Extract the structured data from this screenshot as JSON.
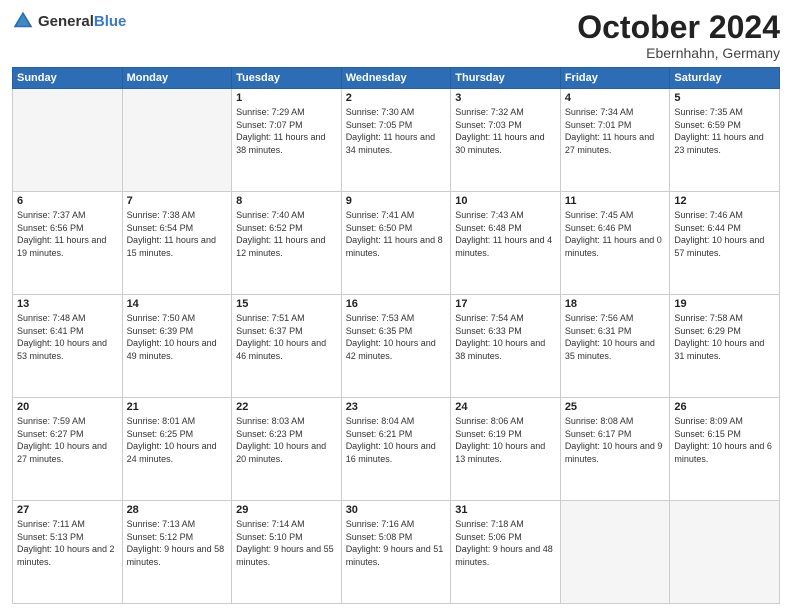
{
  "header": {
    "logo_general": "General",
    "logo_blue": "Blue",
    "title": "October 2024",
    "location": "Ebernhahn, Germany"
  },
  "days_of_week": [
    "Sunday",
    "Monday",
    "Tuesday",
    "Wednesday",
    "Thursday",
    "Friday",
    "Saturday"
  ],
  "weeks": [
    [
      {
        "day": "",
        "info": ""
      },
      {
        "day": "",
        "info": ""
      },
      {
        "day": "1",
        "info": "Sunrise: 7:29 AM\nSunset: 7:07 PM\nDaylight: 11 hours and 38 minutes."
      },
      {
        "day": "2",
        "info": "Sunrise: 7:30 AM\nSunset: 7:05 PM\nDaylight: 11 hours and 34 minutes."
      },
      {
        "day": "3",
        "info": "Sunrise: 7:32 AM\nSunset: 7:03 PM\nDaylight: 11 hours and 30 minutes."
      },
      {
        "day": "4",
        "info": "Sunrise: 7:34 AM\nSunset: 7:01 PM\nDaylight: 11 hours and 27 minutes."
      },
      {
        "day": "5",
        "info": "Sunrise: 7:35 AM\nSunset: 6:59 PM\nDaylight: 11 hours and 23 minutes."
      }
    ],
    [
      {
        "day": "6",
        "info": "Sunrise: 7:37 AM\nSunset: 6:56 PM\nDaylight: 11 hours and 19 minutes."
      },
      {
        "day": "7",
        "info": "Sunrise: 7:38 AM\nSunset: 6:54 PM\nDaylight: 11 hours and 15 minutes."
      },
      {
        "day": "8",
        "info": "Sunrise: 7:40 AM\nSunset: 6:52 PM\nDaylight: 11 hours and 12 minutes."
      },
      {
        "day": "9",
        "info": "Sunrise: 7:41 AM\nSunset: 6:50 PM\nDaylight: 11 hours and 8 minutes."
      },
      {
        "day": "10",
        "info": "Sunrise: 7:43 AM\nSunset: 6:48 PM\nDaylight: 11 hours and 4 minutes."
      },
      {
        "day": "11",
        "info": "Sunrise: 7:45 AM\nSunset: 6:46 PM\nDaylight: 11 hours and 0 minutes."
      },
      {
        "day": "12",
        "info": "Sunrise: 7:46 AM\nSunset: 6:44 PM\nDaylight: 10 hours and 57 minutes."
      }
    ],
    [
      {
        "day": "13",
        "info": "Sunrise: 7:48 AM\nSunset: 6:41 PM\nDaylight: 10 hours and 53 minutes."
      },
      {
        "day": "14",
        "info": "Sunrise: 7:50 AM\nSunset: 6:39 PM\nDaylight: 10 hours and 49 minutes."
      },
      {
        "day": "15",
        "info": "Sunrise: 7:51 AM\nSunset: 6:37 PM\nDaylight: 10 hours and 46 minutes."
      },
      {
        "day": "16",
        "info": "Sunrise: 7:53 AM\nSunset: 6:35 PM\nDaylight: 10 hours and 42 minutes."
      },
      {
        "day": "17",
        "info": "Sunrise: 7:54 AM\nSunset: 6:33 PM\nDaylight: 10 hours and 38 minutes."
      },
      {
        "day": "18",
        "info": "Sunrise: 7:56 AM\nSunset: 6:31 PM\nDaylight: 10 hours and 35 minutes."
      },
      {
        "day": "19",
        "info": "Sunrise: 7:58 AM\nSunset: 6:29 PM\nDaylight: 10 hours and 31 minutes."
      }
    ],
    [
      {
        "day": "20",
        "info": "Sunrise: 7:59 AM\nSunset: 6:27 PM\nDaylight: 10 hours and 27 minutes."
      },
      {
        "day": "21",
        "info": "Sunrise: 8:01 AM\nSunset: 6:25 PM\nDaylight: 10 hours and 24 minutes."
      },
      {
        "day": "22",
        "info": "Sunrise: 8:03 AM\nSunset: 6:23 PM\nDaylight: 10 hours and 20 minutes."
      },
      {
        "day": "23",
        "info": "Sunrise: 8:04 AM\nSunset: 6:21 PM\nDaylight: 10 hours and 16 minutes."
      },
      {
        "day": "24",
        "info": "Sunrise: 8:06 AM\nSunset: 6:19 PM\nDaylight: 10 hours and 13 minutes."
      },
      {
        "day": "25",
        "info": "Sunrise: 8:08 AM\nSunset: 6:17 PM\nDaylight: 10 hours and 9 minutes."
      },
      {
        "day": "26",
        "info": "Sunrise: 8:09 AM\nSunset: 6:15 PM\nDaylight: 10 hours and 6 minutes."
      }
    ],
    [
      {
        "day": "27",
        "info": "Sunrise: 7:11 AM\nSunset: 5:13 PM\nDaylight: 10 hours and 2 minutes."
      },
      {
        "day": "28",
        "info": "Sunrise: 7:13 AM\nSunset: 5:12 PM\nDaylight: 9 hours and 58 minutes."
      },
      {
        "day": "29",
        "info": "Sunrise: 7:14 AM\nSunset: 5:10 PM\nDaylight: 9 hours and 55 minutes."
      },
      {
        "day": "30",
        "info": "Sunrise: 7:16 AM\nSunset: 5:08 PM\nDaylight: 9 hours and 51 minutes."
      },
      {
        "day": "31",
        "info": "Sunrise: 7:18 AM\nSunset: 5:06 PM\nDaylight: 9 hours and 48 minutes."
      },
      {
        "day": "",
        "info": ""
      },
      {
        "day": "",
        "info": ""
      }
    ]
  ]
}
